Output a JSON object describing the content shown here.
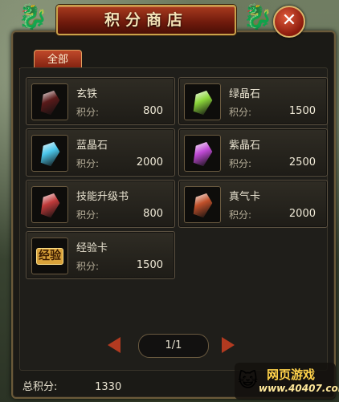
{
  "title": "积分商店",
  "close_symbol": "✕",
  "tab": {
    "label": "全部"
  },
  "price_label": "积分:",
  "items": [
    {
      "name": "玄铁",
      "price": "800",
      "icon": "black-iron-icon",
      "color": "#5a1a1a"
    },
    {
      "name": "绿晶石",
      "price": "1500",
      "icon": "green-crystal-icon",
      "color": "#8bd63a"
    },
    {
      "name": "蓝晶石",
      "price": "2000",
      "icon": "blue-crystal-icon",
      "color": "#4ac6ea"
    },
    {
      "name": "紫晶石",
      "price": "2500",
      "icon": "purple-crystal-icon",
      "color": "#c04ad6"
    },
    {
      "name": "技能升级书",
      "price": "800",
      "icon": "skill-book-icon",
      "color": "#c03a3a"
    },
    {
      "name": "真气卡",
      "price": "2000",
      "icon": "true-qi-card-icon",
      "color": "#c0502a"
    },
    {
      "name": "经验卡",
      "price": "1500",
      "icon": "experience-card-icon",
      "color": "#d9a23a",
      "glyph": "经验"
    }
  ],
  "pager": {
    "text": "1/1"
  },
  "total": {
    "label": "总积分:",
    "value": "1330"
  },
  "watermark": {
    "line1": "网页游戏",
    "line2": "www.40407.com"
  }
}
